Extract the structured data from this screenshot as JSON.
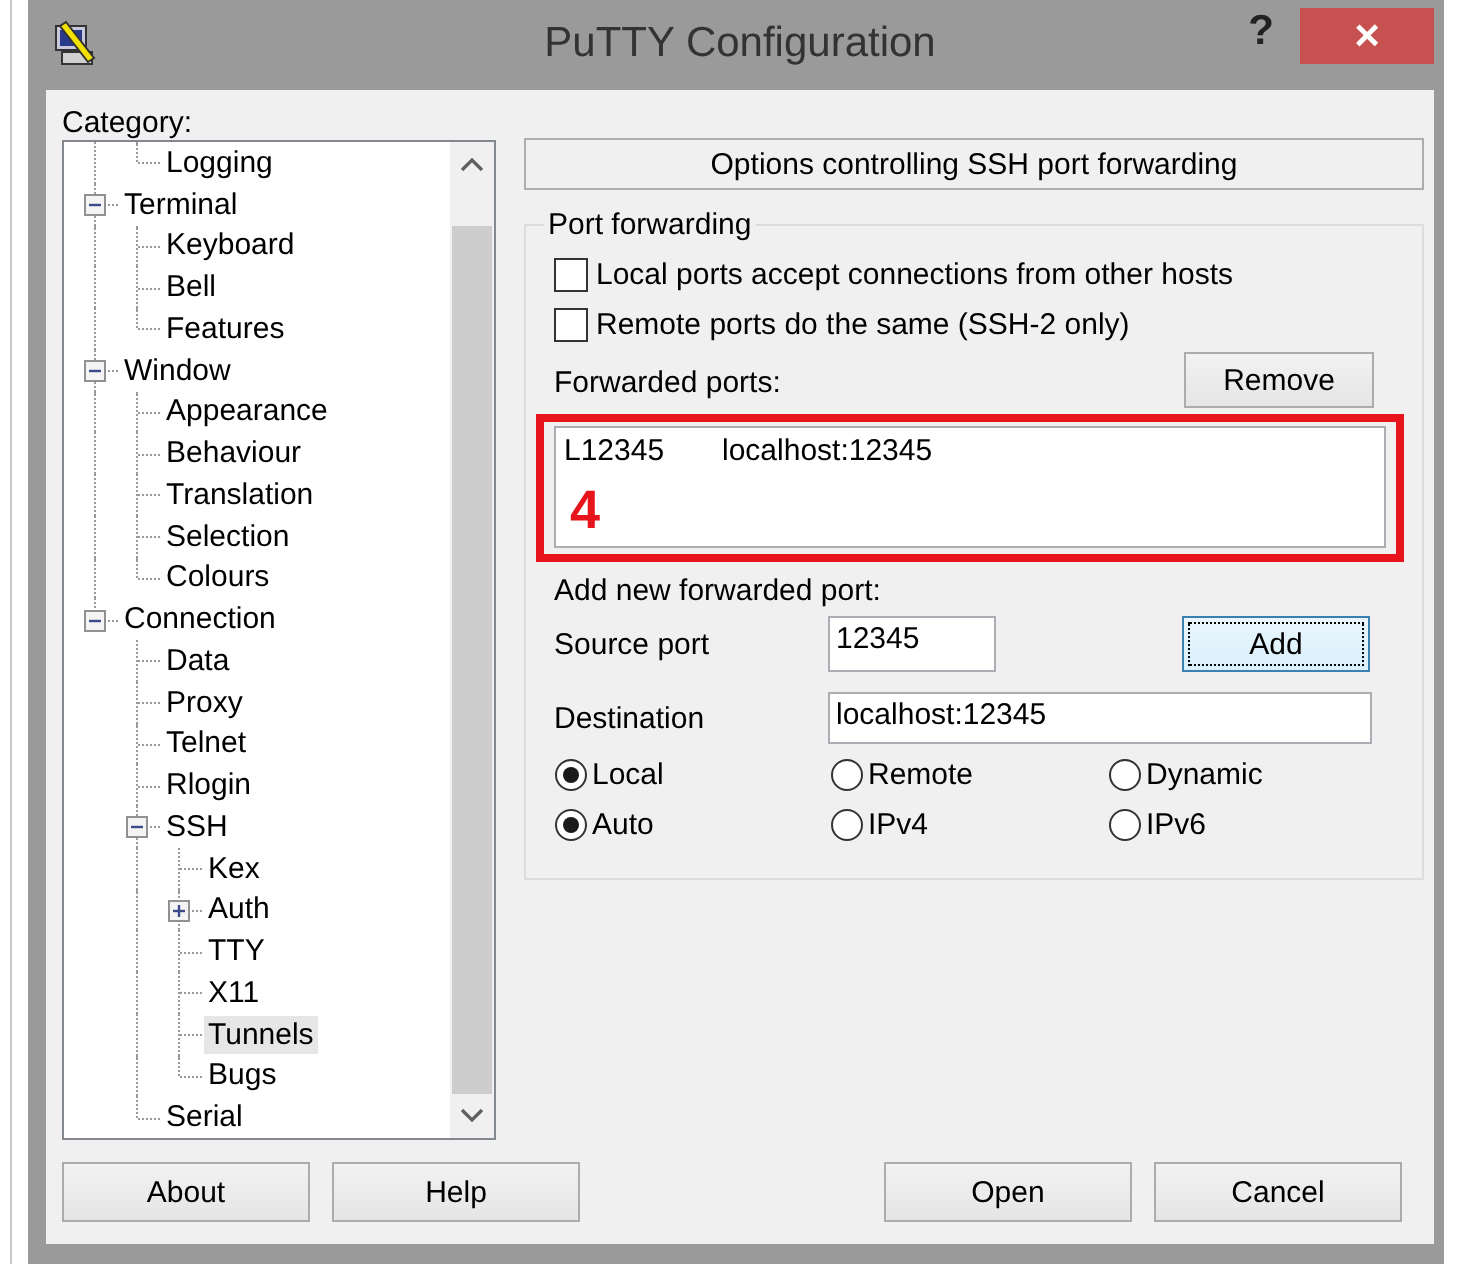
{
  "window": {
    "title": "PuTTY Configuration",
    "help": "?",
    "close": "×"
  },
  "category": {
    "label": "Category:",
    "items": [
      {
        "children": [
          {
            "label": "Logging",
            "selected": false
          }
        ]
      },
      {
        "label": "Terminal",
        "expanded": true,
        "selected": false,
        "children": [
          {
            "label": "Keyboard",
            "selected": false
          },
          {
            "label": "Bell",
            "selected": false
          },
          {
            "label": "Features",
            "selected": false
          }
        ]
      },
      {
        "label": "Window",
        "expanded": true,
        "selected": false,
        "children": [
          {
            "label": "Appearance",
            "selected": false
          },
          {
            "label": "Behaviour",
            "selected": false
          },
          {
            "label": "Translation",
            "selected": false
          },
          {
            "label": "Selection",
            "selected": false
          },
          {
            "label": "Colours",
            "selected": false
          }
        ]
      },
      {
        "label": "Connection",
        "expanded": true,
        "selected": false,
        "children": [
          {
            "label": "Data",
            "selected": false
          },
          {
            "label": "Proxy",
            "selected": false
          },
          {
            "label": "Telnet",
            "selected": false
          },
          {
            "label": "Rlogin",
            "selected": false
          },
          {
            "label": "SSH",
            "expanded": true,
            "selected": false,
            "children": [
              {
                "label": "Kex",
                "selected": false
              },
              {
                "label": "Auth",
                "expanded": false,
                "selected": false
              },
              {
                "label": "TTY",
                "selected": false
              },
              {
                "label": "X11",
                "selected": false
              },
              {
                "label": "Tunnels",
                "selected": true
              },
              {
                "label": "Bugs",
                "selected": false
              }
            ]
          },
          {
            "label": "Serial",
            "selected": false
          }
        ]
      }
    ]
  },
  "panel": {
    "header": "Options controlling SSH port forwarding",
    "group_title": "Port forwarding",
    "checkboxes": [
      {
        "label": "Local ports accept connections from other hosts",
        "checked": false
      },
      {
        "label": "Remote ports do the same (SSH-2 only)",
        "checked": false
      }
    ],
    "forwarded_ports_label": "Forwarded ports:",
    "remove_button": "Remove",
    "forwarded_ports": [
      {
        "source": "L12345",
        "destination": "localhost:12345"
      }
    ],
    "annotation": {
      "label": "4"
    },
    "add_new_label": "Add new forwarded port:",
    "source_port": {
      "label": "Source port",
      "value": "12345"
    },
    "add_button": {
      "label": "Add",
      "focused": true
    },
    "destination": {
      "label": "Destination",
      "value": "localhost:12345"
    },
    "radio_rows": [
      [
        {
          "label": "Local",
          "selected": true
        },
        {
          "label": "Remote",
          "selected": false
        },
        {
          "label": "Dynamic",
          "selected": false
        }
      ],
      [
        {
          "label": "Auto",
          "selected": true
        },
        {
          "label": "IPv4",
          "selected": false
        },
        {
          "label": "IPv6",
          "selected": false
        }
      ]
    ]
  },
  "buttons_left": [
    {
      "label": "About"
    },
    {
      "label": "Help"
    }
  ],
  "buttons_right": [
    {
      "label": "Open"
    },
    {
      "label": "Cancel"
    }
  ]
}
